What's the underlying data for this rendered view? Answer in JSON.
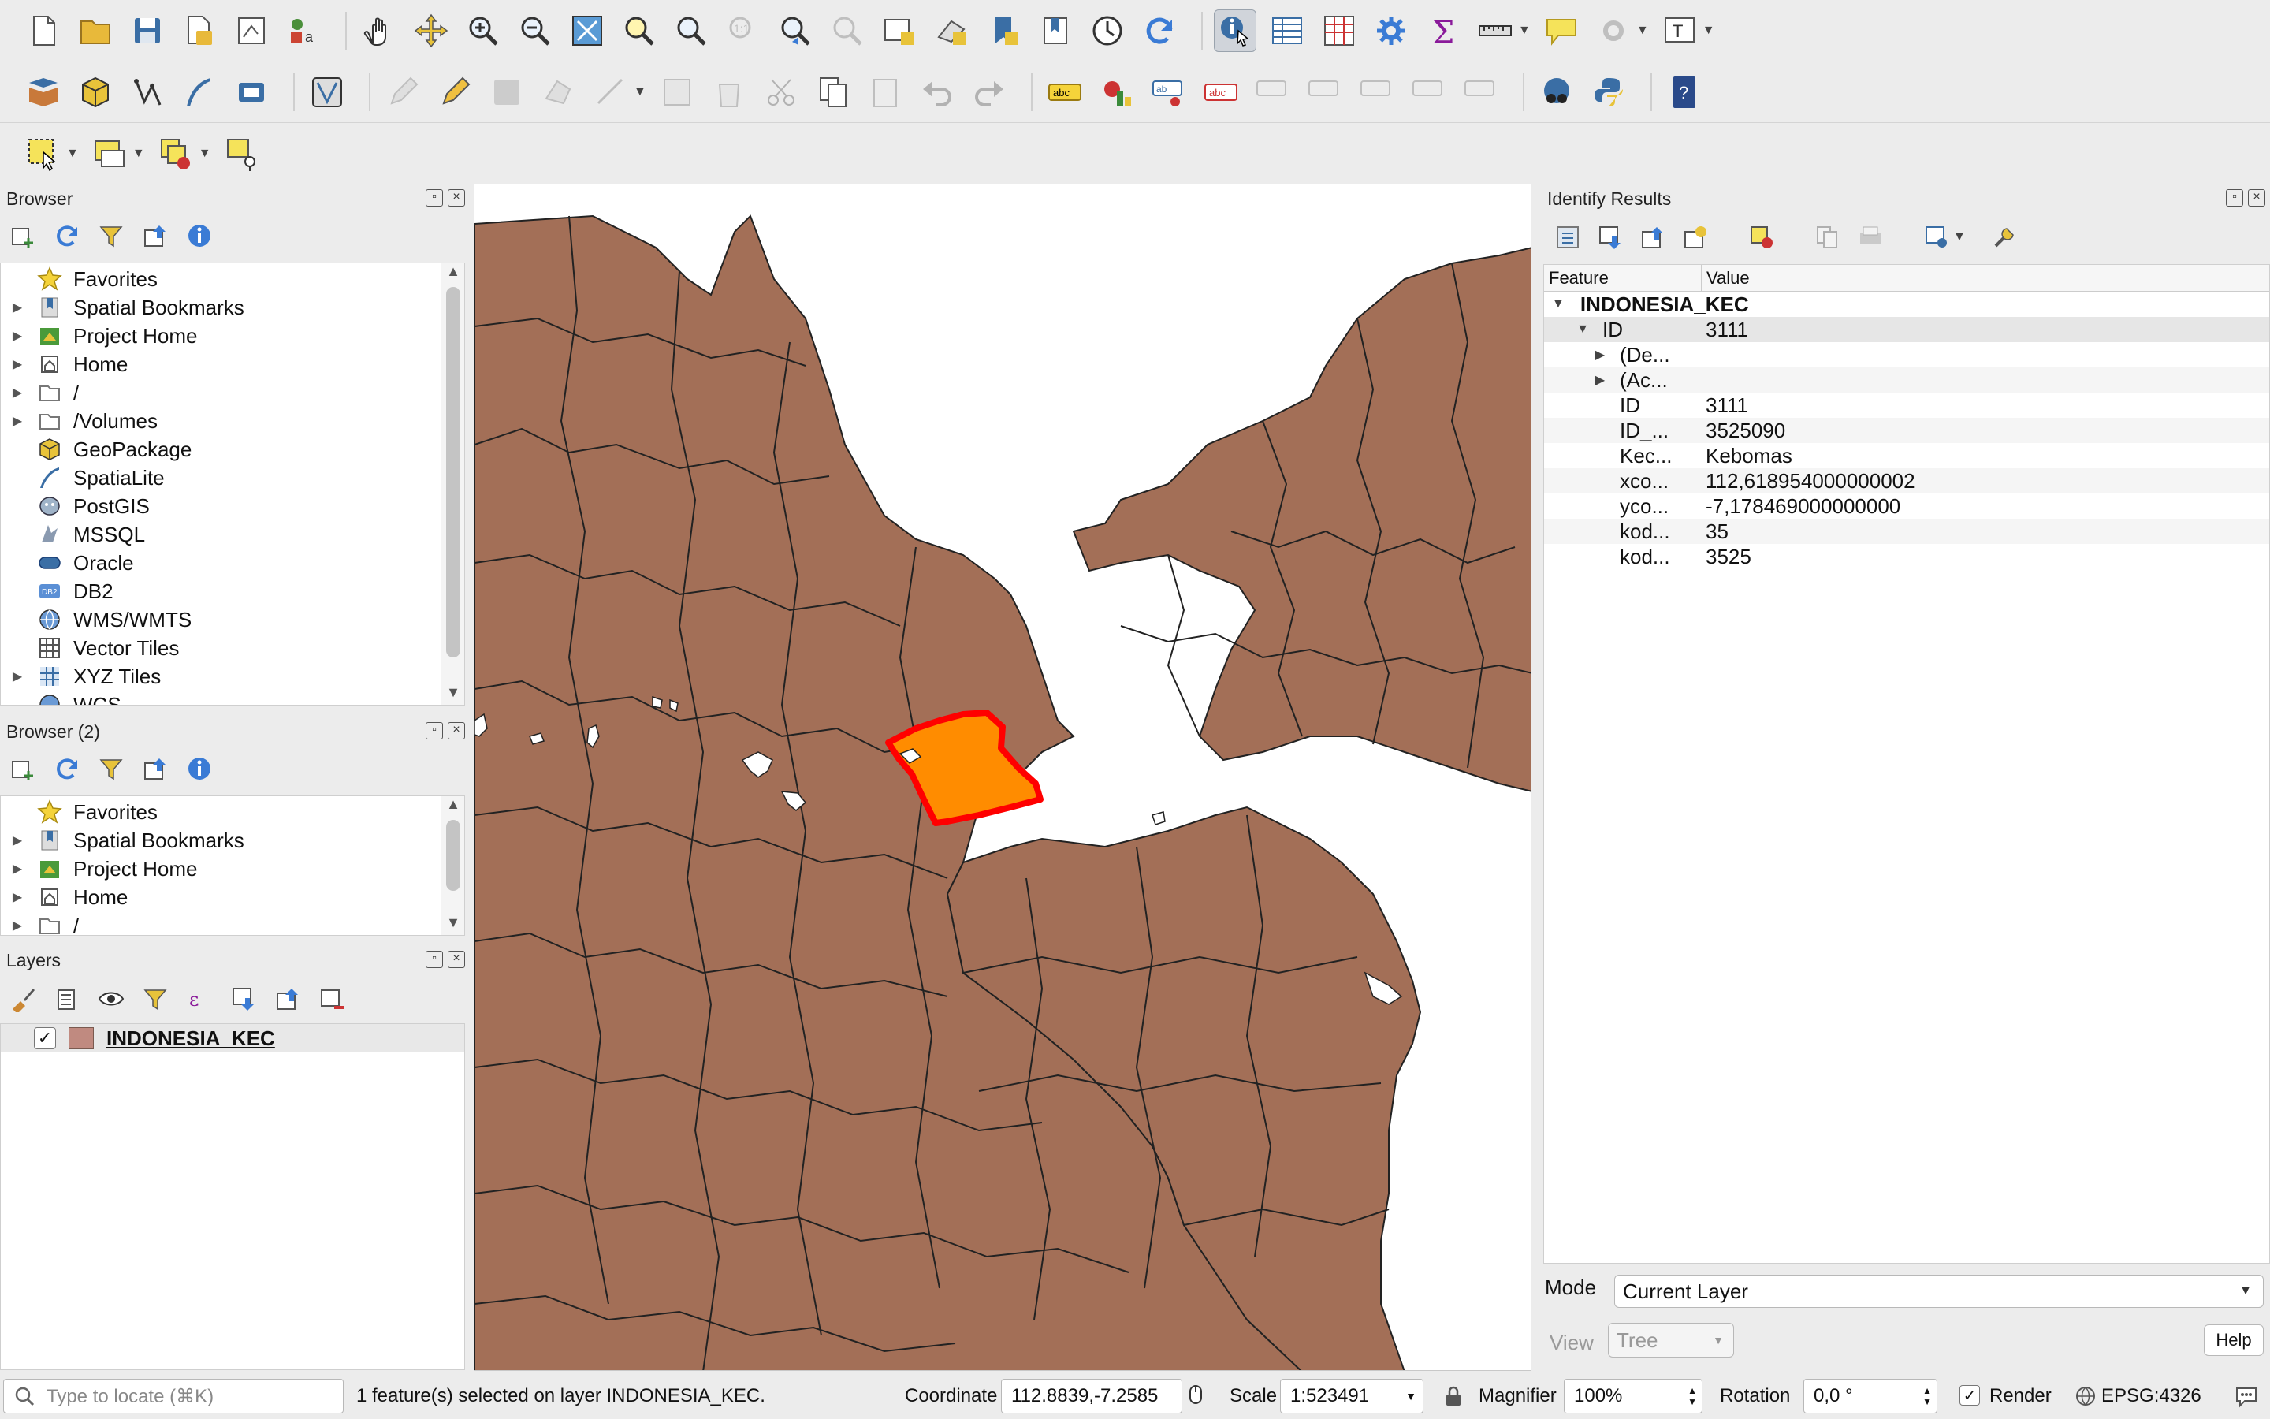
{
  "toolbar1": {
    "icons": [
      "new-project-icon",
      "open-project-icon",
      "save-project-icon",
      "save-as-icon",
      "print-layout-icon",
      "style-manager-icon",
      "pan-icon",
      "pan-to-selection-icon",
      "zoom-in-icon",
      "zoom-out-icon",
      "zoom-full-icon",
      "zoom-to-selection-icon",
      "zoom-to-layer-icon",
      "zoom-native-icon",
      "zoom-last-icon",
      "zoom-next-icon",
      "new-map-view-icon",
      "new-3d-view-icon",
      "new-bookmark-icon",
      "show-bookmarks-icon",
      "temporal-controller-icon",
      "refresh-icon",
      "identify-icon",
      "attribute-table-icon",
      "field-calculator-icon",
      "processing-toolbox-icon",
      "statistics-icon",
      "measure-icon",
      "map-tips-icon",
      "settings-icon",
      "text-annotation-icon"
    ]
  },
  "browser": {
    "title": "Browser",
    "items": [
      {
        "label": "Favorites",
        "icon": "star-icon"
      },
      {
        "label": "Spatial Bookmarks",
        "icon": "bookmark-icon"
      },
      {
        "label": "Project Home",
        "icon": "project-home-icon"
      },
      {
        "label": "Home",
        "icon": "home-icon"
      },
      {
        "label": "/",
        "icon": "folder-icon"
      },
      {
        "label": "/Volumes",
        "icon": "folder-icon"
      },
      {
        "label": "GeoPackage",
        "icon": "geopackage-icon"
      },
      {
        "label": "SpatiaLite",
        "icon": "spatialite-icon"
      },
      {
        "label": "PostGIS",
        "icon": "postgis-icon"
      },
      {
        "label": "MSSQL",
        "icon": "mssql-icon"
      },
      {
        "label": "Oracle",
        "icon": "oracle-icon"
      },
      {
        "label": "DB2",
        "icon": "db2-icon"
      },
      {
        "label": "WMS/WMTS",
        "icon": "wms-icon"
      },
      {
        "label": "Vector Tiles",
        "icon": "vector-tiles-icon"
      },
      {
        "label": "XYZ Tiles",
        "icon": "xyz-tiles-icon"
      },
      {
        "label": "WCS",
        "icon": "wcs-icon"
      }
    ]
  },
  "browser2": {
    "title": "Browser (2)",
    "items": [
      {
        "label": "Favorites"
      },
      {
        "label": "Spatial Bookmarks"
      },
      {
        "label": "Project Home"
      },
      {
        "label": "Home"
      },
      {
        "label": "/"
      }
    ]
  },
  "layers": {
    "title": "Layers",
    "layer_name": "INDONESIA_KEC",
    "layer_color": "#c08a80",
    "checked": true
  },
  "map": {
    "fill_color": "#a36f57",
    "selected_fill": "#ff8c00",
    "selected_stroke": "#ff0000"
  },
  "identify": {
    "title": "Identify Results",
    "col_feature": "Feature",
    "col_value": "Value",
    "layer": "INDONESIA_KEC",
    "rows": [
      {
        "feature": "ID",
        "value": "3111"
      },
      {
        "feature": "(De...",
        "value": ""
      },
      {
        "feature": "(Ac...",
        "value": ""
      },
      {
        "feature": "ID",
        "value": "3111"
      },
      {
        "feature": "ID_...",
        "value": "3525090"
      },
      {
        "feature": "Kec...",
        "value": "Kebomas"
      },
      {
        "feature": "xco...",
        "value": "112,618954000000002"
      },
      {
        "feature": "yco...",
        "value": "-7,178469000000000"
      },
      {
        "feature": "kod...",
        "value": "35"
      },
      {
        "feature": "kod...",
        "value": "3525"
      }
    ],
    "mode_label": "Mode",
    "mode_value": "Current Layer",
    "view_label": "View",
    "view_value": "Tree",
    "help_label": "Help"
  },
  "status": {
    "locate_placeholder": "Type to locate (⌘K)",
    "message": "1 feature(s) selected on layer INDONESIA_KEC.",
    "coordinate_label": "Coordinate",
    "coordinate_value": "112.8839,-7.2585",
    "scale_label": "Scale",
    "scale_value": "1:523491",
    "magnifier_label": "Magnifier",
    "magnifier_value": "100%",
    "rotation_label": "Rotation",
    "rotation_value": "0,0 °",
    "render_label": "Render",
    "render_checked": true,
    "crs": "EPSG:4326"
  }
}
